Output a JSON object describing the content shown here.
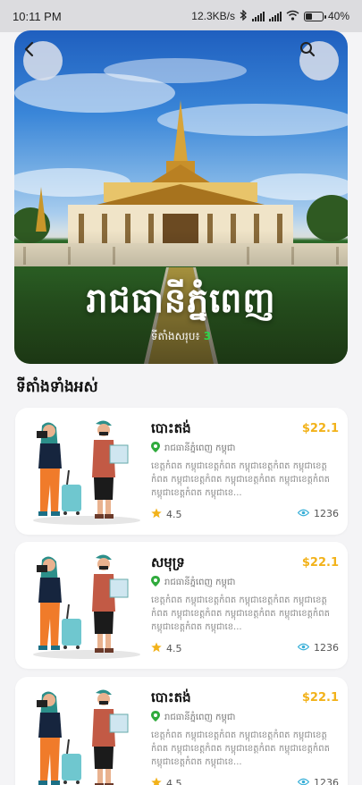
{
  "status_bar": {
    "time": "10:11 PM",
    "network_speed": "12.3KB/s",
    "battery_percent": "40%",
    "battery_level": 0.4
  },
  "hero": {
    "title": "រាជធានីភ្នំពេញ",
    "subtitle_label": "ទីតាំងសរុប៖",
    "subtitle_count": "3",
    "back_icon": "chevron-left-icon",
    "search_icon": "search-icon",
    "count_color": "#2fd44a"
  },
  "section": {
    "title": "ទីតាំងទាំងអស់"
  },
  "colors": {
    "price": "#f2b21a",
    "location_pin": "#2faa3c",
    "star": "#f2b21a",
    "eye": "#3ab0d8"
  },
  "places": [
    {
      "name": "បោះតង់",
      "price": "$22.1",
      "location": "រាជធានីភ្នំពេញ កម្ពុជា",
      "description": "ខេត្តកំពត កម្ពុជាខេត្តកំពត កម្ពុជាខេត្តកំពត កម្ពុជាខេត្តកំពត កម្ពុជាខេត្តកំពត កម្ពុជាខេត្តកំពត កម្ពុជាខេត្តកំពត កម្ពុជាខេត្តកំពត កម្ពុជាខេ...",
      "rating": "4.5",
      "views": "1236"
    },
    {
      "name": "សមុទ្រ",
      "price": "$22.1",
      "location": "រាជធានីភ្នំពេញ កម្ពុជា",
      "description": "ខេត្តកំពត កម្ពុជាខេត្តកំពត កម្ពុជាខេត្តកំពត កម្ពុជាខេត្តកំពត កម្ពុជាខេត្តកំពត កម្ពុជាខេត្តកំពត កម្ពុជាខេត្តកំពត កម្ពុជាខេត្តកំពត កម្ពុជាខេ...",
      "rating": "4.5",
      "views": "1236"
    },
    {
      "name": "បោះតង់",
      "price": "$22.1",
      "location": "រាជធានីភ្នំពេញ កម្ពុជា",
      "description": "ខេត្តកំពត កម្ពុជាខេត្តកំពត កម្ពុជាខេត្តកំពត កម្ពុជាខេត្តកំពត កម្ពុជាខេត្តកំពត កម្ពុជាខេត្តកំពត កម្ពុជាខេត្តកំពត កម្ពុជាខេត្តកំពត កម្ពុជាខេ...",
      "rating": "4.5",
      "views": "1236"
    }
  ]
}
